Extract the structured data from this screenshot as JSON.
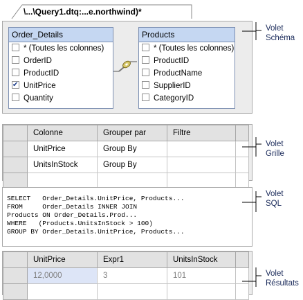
{
  "tab": {
    "title": "\\...\\Query1.dtq:...e.northwind)*"
  },
  "diagram": {
    "tables": [
      {
        "name": "Order_Details",
        "columns": [
          {
            "label": "* (Toutes les colonnes)",
            "checked": false
          },
          {
            "label": "OrderID",
            "checked": false
          },
          {
            "label": "ProductID",
            "checked": false
          },
          {
            "label": "UnitPrice",
            "checked": true
          },
          {
            "label": "Quantity",
            "checked": false
          }
        ]
      },
      {
        "name": "Products",
        "columns": [
          {
            "label": "* (Toutes les colonnes)",
            "checked": false
          },
          {
            "label": "ProductID",
            "checked": false
          },
          {
            "label": "ProductName",
            "checked": false
          },
          {
            "label": "SupplierID",
            "checked": false
          },
          {
            "label": "CategoryID",
            "checked": false
          }
        ]
      }
    ]
  },
  "grid": {
    "headers": [
      "Colonne",
      "Grouper par",
      "Filtre"
    ],
    "rows": [
      {
        "column": "UnitPrice",
        "group": "Group By",
        "filter": ""
      },
      {
        "column": "UnitsInStock",
        "group": "Group By",
        "filter": ""
      }
    ]
  },
  "sql": {
    "lines": [
      "SELECT   Order_Details.UnitPrice, Products...",
      "FROM     Order_Details INNER JOIN",
      "Products ON Order_Details.Prod...",
      "WHERE   (Products.UnitsInStock > 100)",
      "GROUP BY Order_Details.UnitPrice, Products..."
    ]
  },
  "results": {
    "headers": [
      "UnitPrice",
      "Expr1",
      "UnitsInStock"
    ],
    "rows": [
      {
        "unitprice": "12,0000",
        "expr1": "3",
        "unitsinstock": "101"
      }
    ]
  },
  "labels": {
    "schema": [
      "Volet",
      "Schéma"
    ],
    "grid": [
      "Volet",
      "Grille"
    ],
    "sql": [
      "Volet",
      "SQL"
    ],
    "results": [
      "Volet",
      "Résultats"
    ]
  }
}
